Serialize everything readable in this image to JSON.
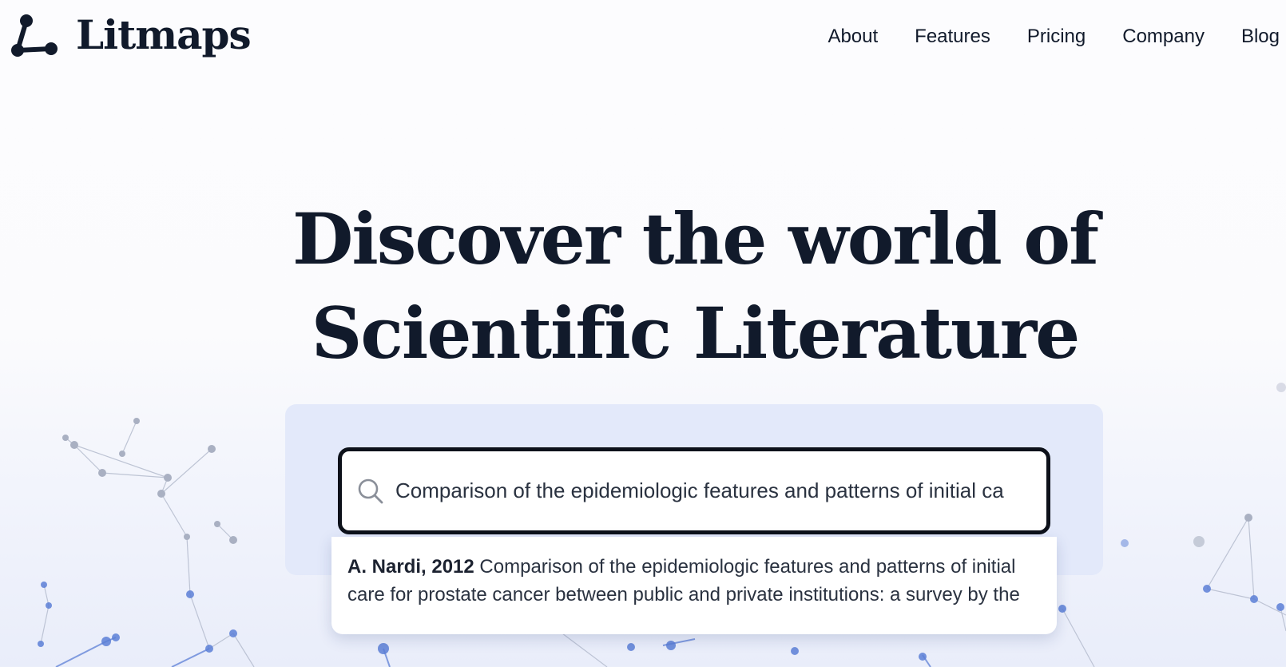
{
  "brand": {
    "name": "Litmaps"
  },
  "nav": {
    "items": [
      {
        "label": "About"
      },
      {
        "label": "Features"
      },
      {
        "label": "Pricing"
      },
      {
        "label": "Company"
      },
      {
        "label": "Blog"
      }
    ]
  },
  "hero": {
    "title_line1": "Discover the world of",
    "title_line2": "Scientific Literature"
  },
  "search": {
    "value": "Comparison of the epidemiologic features and patterns of initial ca",
    "results": [
      {
        "meta": "A. Nardi, 2012",
        "title": "Comparison of the epidemiologic features and patterns of initial care for prostate cancer between public and private institutions: a survey by the"
      }
    ]
  },
  "colors": {
    "text": "#111a2b",
    "panel": "#e3e9fa",
    "search_border": "#0d111a",
    "network_node": "#5c7fd6"
  },
  "icons": {
    "logo": "litmaps-logo-icon",
    "search": "search-icon"
  }
}
